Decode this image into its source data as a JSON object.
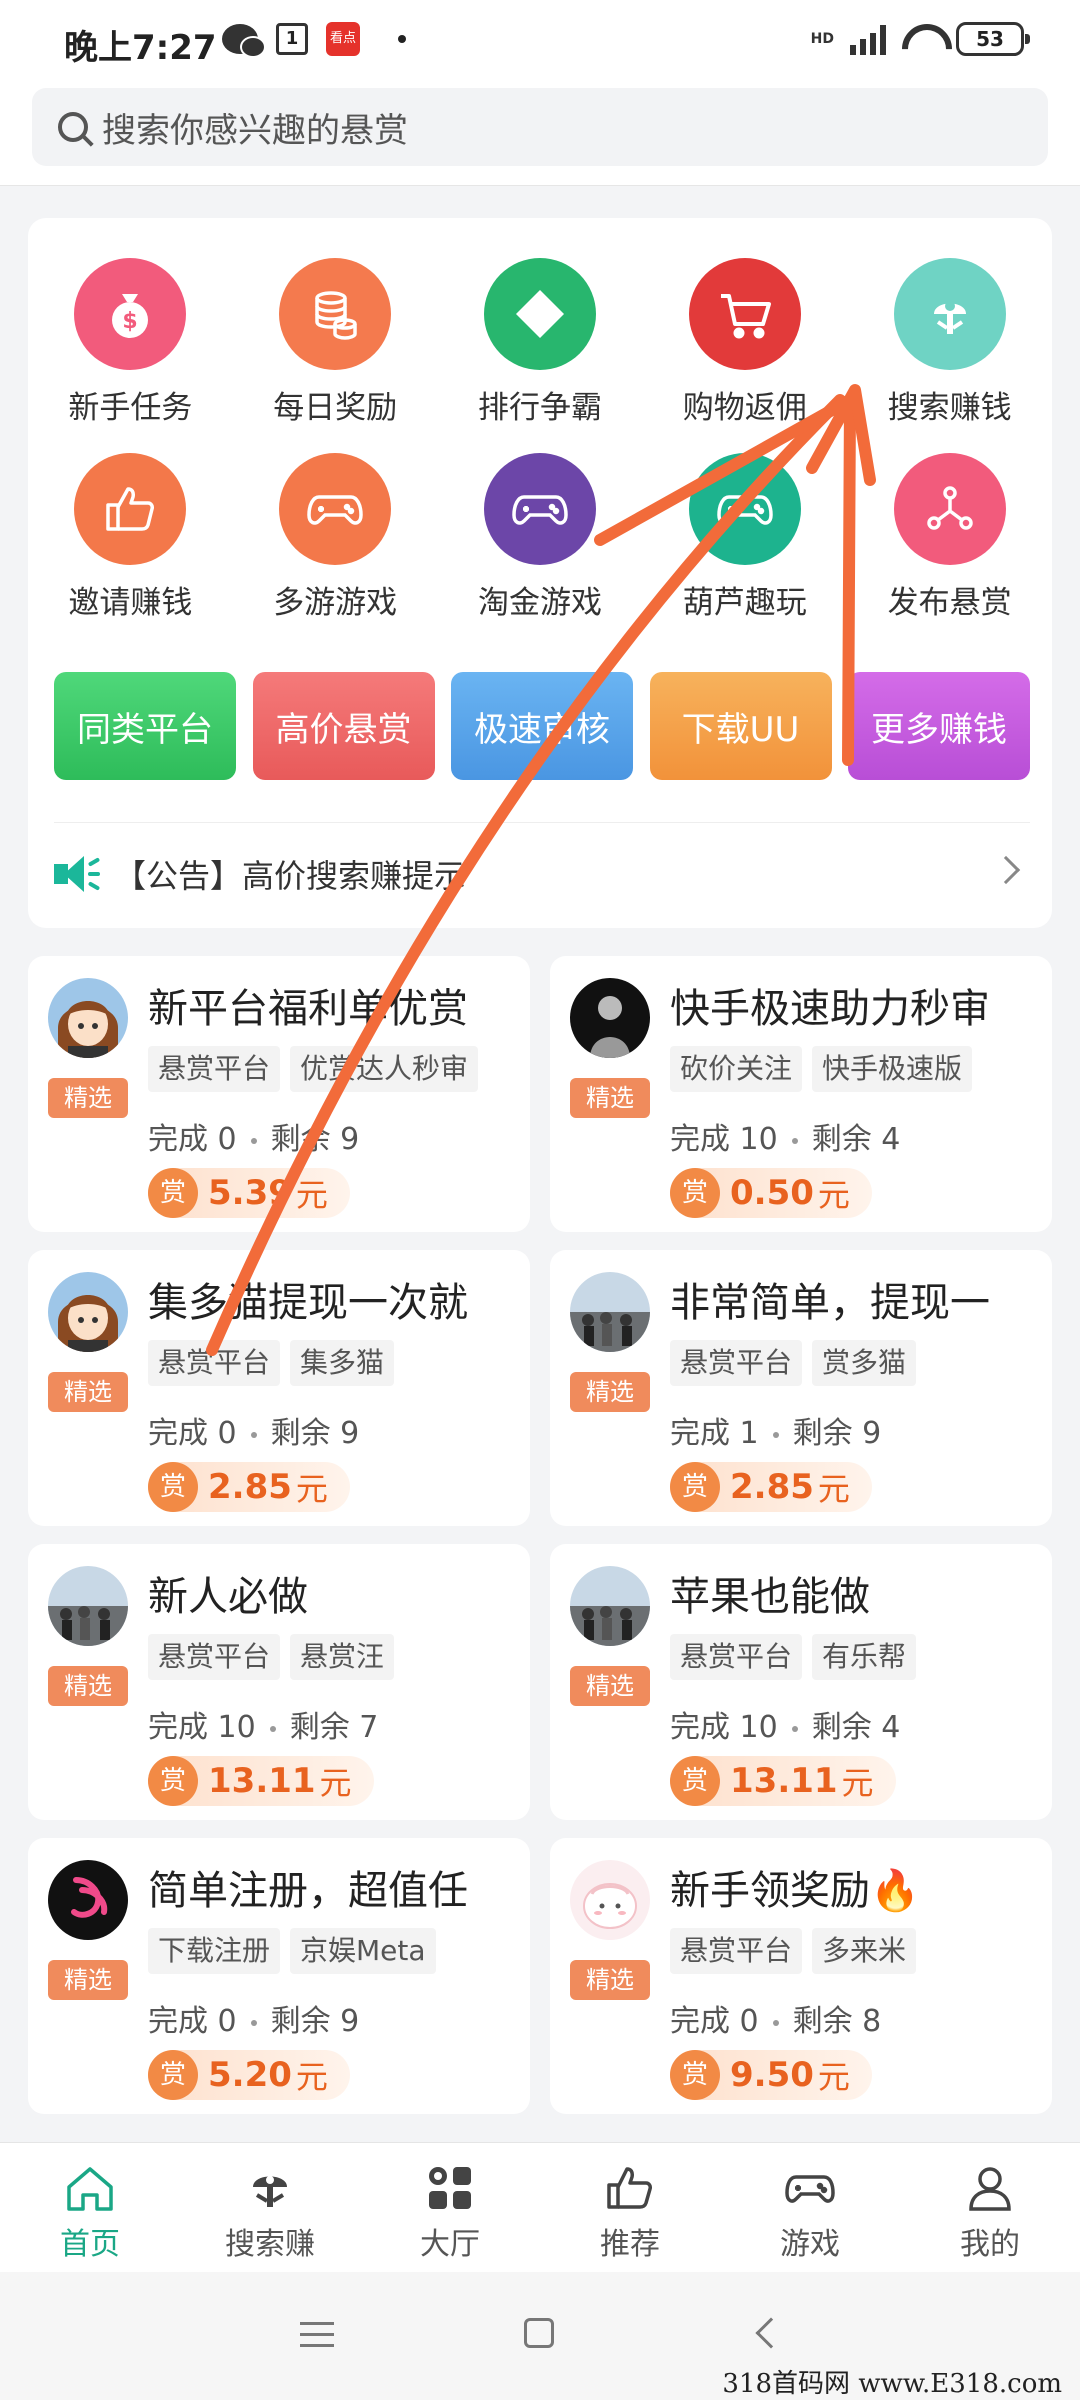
{
  "status_bar": {
    "time": "晚上7:27",
    "calendar_day": "1",
    "app_badge": "看点",
    "network": "HD",
    "battery": "53"
  },
  "search": {
    "placeholder": "搜索你感兴趣的悬赏"
  },
  "grid": [
    {
      "label": "新手任务",
      "icon": "money-bag-icon",
      "color": "#f25b7c"
    },
    {
      "label": "每日奖励",
      "icon": "coins-icon",
      "color": "#f47a4e"
    },
    {
      "label": "排行争霸",
      "icon": "diamond-icon",
      "color": "#28b66e"
    },
    {
      "label": "购物返佣",
      "icon": "cart-icon",
      "color": "#e23a3a"
    },
    {
      "label": "搜索赚钱",
      "icon": "search-earn-icon",
      "color": "#6fd3c4"
    },
    {
      "label": "邀请赚钱",
      "icon": "thumb-up-icon",
      "color": "#f3784a"
    },
    {
      "label": "多游游戏",
      "icon": "gamepad-icon",
      "color": "#f3784a"
    },
    {
      "label": "淘金游戏",
      "icon": "gamepad-icon",
      "color": "#6c46a8"
    },
    {
      "label": "葫芦趣玩",
      "icon": "gamepad-icon",
      "color": "#1db38e"
    },
    {
      "label": "发布悬赏",
      "icon": "share-node-icon",
      "color": "#f25b7c"
    }
  ],
  "quick_buttons": [
    {
      "label": "同类平台",
      "color": "#3ecb6a"
    },
    {
      "label": "高价悬赏",
      "color": "#f06a6a"
    },
    {
      "label": "极速审核",
      "color": "#5aa6ec"
    },
    {
      "label": "下载UU",
      "color": "#f5a34a"
    },
    {
      "label": "更多赚钱",
      "color": "#c85ee0"
    }
  ],
  "notice": {
    "text": "【公告】高价搜索赚提示"
  },
  "tasks": [
    {
      "title": "新平台福利单优赏",
      "tags": [
        "悬赏平台",
        "优赏达人秒审"
      ],
      "done": "完成 0",
      "remaining": "剩余 9",
      "reward": "5.39",
      "unit": "元",
      "badge": "精选",
      "reward_label": "赏",
      "avatar": "anime"
    },
    {
      "title": "快手极速助力秒审",
      "tags": [
        "砍价关注",
        "快手极速版"
      ],
      "done": "完成 10",
      "remaining": "剩余 4",
      "reward": "0.50",
      "unit": "元",
      "badge": "精选",
      "reward_label": "赏",
      "avatar": "dark"
    },
    {
      "title": "集多猫提现一次就",
      "tags": [
        "悬赏平台",
        "集多猫"
      ],
      "done": "完成 0",
      "remaining": "剩余 9",
      "reward": "2.85",
      "unit": "元",
      "badge": "精选",
      "reward_label": "赏",
      "avatar": "anime"
    },
    {
      "title": "非常简单，提现一",
      "tags": [
        "悬赏平台",
        "赏多猫"
      ],
      "done": "完成 1",
      "remaining": "剩余 9",
      "reward": "2.85",
      "unit": "元",
      "badge": "精选",
      "reward_label": "赏",
      "avatar": "photo"
    },
    {
      "title": "新人必做",
      "tags": [
        "悬赏平台",
        "悬赏汪"
      ],
      "done": "完成 10",
      "remaining": "剩余 7",
      "reward": "13.11",
      "unit": "元",
      "badge": "精选",
      "reward_label": "赏",
      "avatar": "photo"
    },
    {
      "title": "苹果也能做",
      "tags": [
        "悬赏平台",
        "有乐帮"
      ],
      "done": "完成 10",
      "remaining": "剩余 4",
      "reward": "13.11",
      "unit": "元",
      "badge": "精选",
      "reward_label": "赏",
      "avatar": "photo"
    },
    {
      "title": "简单注册，超值任",
      "tags": [
        "下载注册",
        "京娱Meta"
      ],
      "done": "完成 0",
      "remaining": "剩余 9",
      "reward": "5.20",
      "unit": "元",
      "badge": "精选",
      "reward_label": "赏",
      "avatar": "logo"
    },
    {
      "title": "新手领奖励🔥",
      "tags": [
        "悬赏平台",
        "多来米"
      ],
      "done": "完成 0",
      "remaining": "剩余 8",
      "reward": "9.50",
      "unit": "元",
      "badge": "精选",
      "reward_label": "赏",
      "avatar": "cute"
    }
  ],
  "bottom_nav": [
    {
      "label": "首页",
      "icon": "home-icon",
      "active": true
    },
    {
      "label": "搜索赚",
      "icon": "search-earn-icon",
      "active": false
    },
    {
      "label": "大厅",
      "icon": "hall-icon",
      "active": false
    },
    {
      "label": "推荐",
      "icon": "thumb-up-icon",
      "active": false
    },
    {
      "label": "游戏",
      "icon": "gamepad-icon",
      "active": false
    },
    {
      "label": "我的",
      "icon": "user-icon",
      "active": false
    }
  ],
  "watermark": "318首码网 www.E318.com",
  "accent_color": "#1aa786"
}
